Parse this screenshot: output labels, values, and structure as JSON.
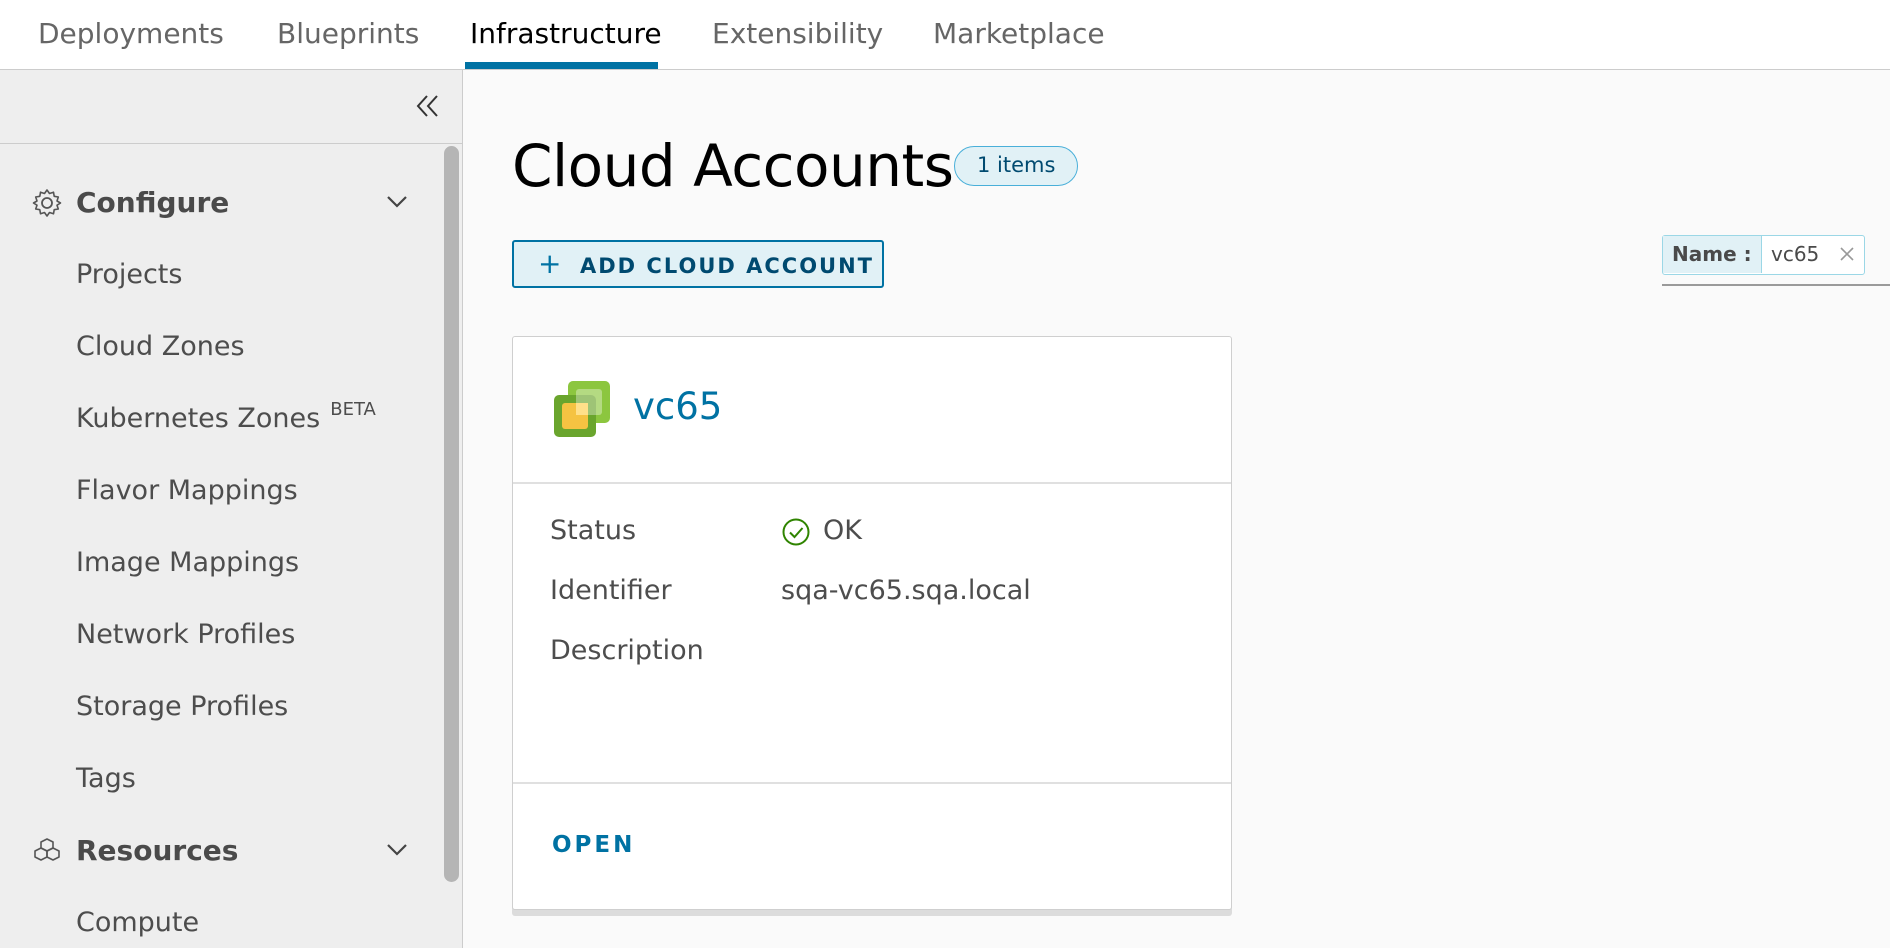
{
  "topnav": {
    "tabs": [
      {
        "label": "Deployments"
      },
      {
        "label": "Blueprints"
      },
      {
        "label": "Infrastructure",
        "active": true
      },
      {
        "label": "Extensibility"
      },
      {
        "label": "Marketplace"
      }
    ]
  },
  "sidebar": {
    "collapse_icon": "double-chevron-left-icon",
    "configure": {
      "label": "Configure",
      "icon": "gear-icon",
      "items": [
        {
          "label": "Projects"
        },
        {
          "label": "Cloud Zones"
        },
        {
          "label": "Kubernetes Zones",
          "badge": "BETA"
        },
        {
          "label": "Flavor Mappings"
        },
        {
          "label": "Image Mappings"
        },
        {
          "label": "Network Profiles"
        },
        {
          "label": "Storage Profiles"
        },
        {
          "label": "Tags"
        }
      ]
    },
    "resources": {
      "label": "Resources",
      "icon": "cubes-icon",
      "items": [
        {
          "label": "Compute"
        }
      ]
    }
  },
  "main": {
    "title": "Cloud Accounts",
    "count_badge": "1 items",
    "add_button": {
      "icon": "plus-icon",
      "label": "ADD CLOUD ACCOUNT"
    },
    "filter": {
      "key": "Name :",
      "value": "vc65"
    },
    "card": {
      "name": "vc65",
      "logo": "vsphere-logo",
      "status_label": "Status",
      "status_value": "OK",
      "status_color": "#2f8400",
      "identifier_label": "Identifier",
      "identifier_value": "sqa-vc65.sqa.local",
      "description_label": "Description",
      "open_label": "OPEN"
    }
  },
  "colors": {
    "accent": "#0072a3",
    "tab_active_underline": "#0072a3",
    "sidebar_bg": "#eeeeee",
    "badge_bg": "#e1f1f6"
  }
}
